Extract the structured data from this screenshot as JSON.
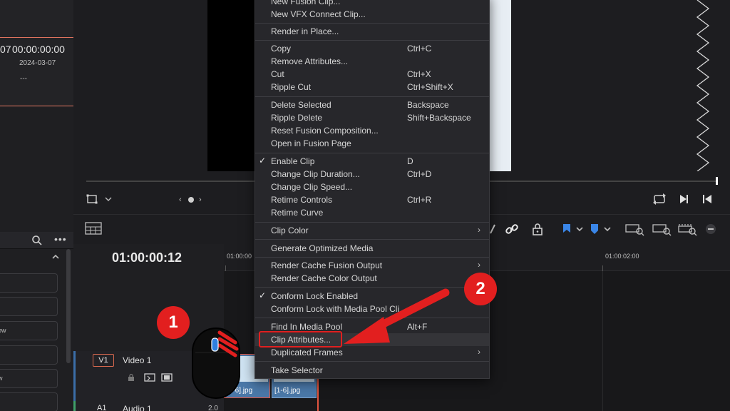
{
  "left_panel": {
    "timecode_partial": "07",
    "timecode": "00:00:00:00",
    "date": "2024-03-07",
    "dash": "---",
    "list_items": [
      "",
      "",
      "ow",
      "",
      "w",
      ""
    ]
  },
  "timeline": {
    "timecode": "01:00:00:12",
    "ruler_label_1": "01:00:00",
    "ruler_label_2": "01:00:02:00",
    "tracks": {
      "video": {
        "badge": "V1",
        "name": "Video 1"
      },
      "audio": {
        "badge": "A1",
        "name": "Audio 1",
        "level": "2.0"
      }
    },
    "clips": [
      {
        "label": "[1-6].jpg"
      },
      {
        "label": "[1-6].jpg"
      }
    ]
  },
  "context_menu": {
    "items": [
      {
        "id": "new-fusion-clip",
        "label": "New Fusion Clip...",
        "shortcut": "",
        "check": "",
        "submenu": ""
      },
      {
        "id": "new-vfx-connect-clip",
        "label": "New VFX Connect Clip...",
        "shortcut": "",
        "check": "",
        "submenu": ""
      },
      {
        "id": "render-in-place",
        "label": "Render in Place...",
        "shortcut": "",
        "check": "",
        "submenu": ""
      },
      {
        "id": "copy",
        "label": "Copy",
        "shortcut": "Ctrl+C",
        "check": "",
        "submenu": ""
      },
      {
        "id": "remove-attributes",
        "label": "Remove Attributes...",
        "shortcut": "",
        "check": "",
        "submenu": ""
      },
      {
        "id": "cut",
        "label": "Cut",
        "shortcut": "Ctrl+X",
        "check": "",
        "submenu": ""
      },
      {
        "id": "ripple-cut",
        "label": "Ripple Cut",
        "shortcut": "Ctrl+Shift+X",
        "check": "",
        "submenu": ""
      },
      {
        "id": "delete-selected",
        "label": "Delete Selected",
        "shortcut": "Backspace",
        "check": "",
        "submenu": ""
      },
      {
        "id": "ripple-delete",
        "label": "Ripple Delete",
        "shortcut": "Shift+Backspace",
        "check": "",
        "submenu": ""
      },
      {
        "id": "reset-fusion-composition",
        "label": "Reset Fusion Composition...",
        "shortcut": "",
        "check": "",
        "submenu": ""
      },
      {
        "id": "open-in-fusion-page",
        "label": "Open in Fusion Page",
        "shortcut": "",
        "check": "",
        "submenu": ""
      },
      {
        "id": "enable-clip",
        "label": "Enable Clip",
        "shortcut": "D",
        "check": "✓",
        "submenu": ""
      },
      {
        "id": "change-clip-duration",
        "label": "Change Clip Duration...",
        "shortcut": "Ctrl+D",
        "check": "",
        "submenu": ""
      },
      {
        "id": "change-clip-speed",
        "label": "Change Clip Speed...",
        "shortcut": "",
        "check": "",
        "submenu": ""
      },
      {
        "id": "retime-controls",
        "label": "Retime Controls",
        "shortcut": "Ctrl+R",
        "check": "",
        "submenu": ""
      },
      {
        "id": "retime-curve",
        "label": "Retime Curve",
        "shortcut": "",
        "check": "",
        "submenu": ""
      },
      {
        "id": "clip-color",
        "label": "Clip Color",
        "shortcut": "",
        "check": "",
        "submenu": "›"
      },
      {
        "id": "generate-optimized-media",
        "label": "Generate Optimized Media",
        "shortcut": "",
        "check": "",
        "submenu": ""
      },
      {
        "id": "render-cache-fusion-output",
        "label": "Render Cache Fusion Output",
        "shortcut": "",
        "check": "",
        "submenu": "›"
      },
      {
        "id": "render-cache-color-output",
        "label": "Render Cache Color Output",
        "shortcut": "",
        "check": "",
        "submenu": ""
      },
      {
        "id": "conform-lock-enabled",
        "label": "Conform Lock Enabled",
        "shortcut": "",
        "check": "✓",
        "submenu": ""
      },
      {
        "id": "conform-lock-media-pool",
        "label": "Conform Lock with Media Pool Cli",
        "shortcut": "",
        "check": "",
        "submenu": ""
      },
      {
        "id": "find-in-media-pool",
        "label": "Find In Media Pool",
        "shortcut": "Alt+F",
        "check": "",
        "submenu": ""
      },
      {
        "id": "clip-attributes",
        "label": "Clip Attributes...",
        "shortcut": "",
        "check": "",
        "submenu": ""
      },
      {
        "id": "duplicated-frames",
        "label": "Duplicated Frames",
        "shortcut": "",
        "check": "",
        "submenu": "›"
      },
      {
        "id": "take-selector",
        "label": "Take Selector",
        "shortcut": "",
        "check": "",
        "submenu": ""
      }
    ]
  },
  "annotations": {
    "step_1": "1",
    "step_2": "2",
    "accent_color": "#e21f1f"
  },
  "colors": {
    "background": "#1b1b1d",
    "menu_background": "#27272b",
    "clip_blue": "#4a78a8",
    "playhead_red": "#e2543f"
  }
}
